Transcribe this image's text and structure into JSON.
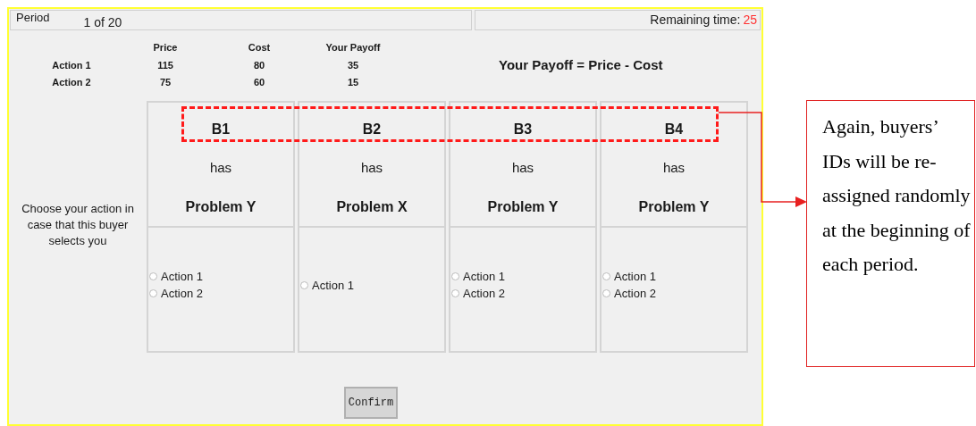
{
  "header": {
    "period_label": "Period",
    "period_value": "1 of 20",
    "remaining_label": "Remaining time:",
    "remaining_value": "25"
  },
  "payoff_table": {
    "columns": [
      "Price",
      "Cost",
      "Your Payoff"
    ],
    "rows": [
      {
        "label": "Action 1",
        "cells": [
          "115",
          "80",
          "35"
        ]
      },
      {
        "label": "Action 2",
        "cells": [
          "75",
          "60",
          "15"
        ]
      }
    ]
  },
  "formula": "Your Payoff = Price - Cost",
  "prompt": "Choose your action in case that this buyer selects you",
  "buyers": [
    {
      "id": "B1",
      "has": "has",
      "problem": "Problem Y",
      "options": [
        {
          "label": "Action 1",
          "selected": false
        },
        {
          "label": "Action 2",
          "selected": false
        }
      ]
    },
    {
      "id": "B2",
      "has": "has",
      "problem": "Problem X",
      "options": [
        {
          "label": "Action 1",
          "selected": false
        }
      ]
    },
    {
      "id": "B3",
      "has": "has",
      "problem": "Problem Y",
      "options": [
        {
          "label": "Action 1",
          "selected": false
        },
        {
          "label": "Action 2",
          "selected": false
        }
      ]
    },
    {
      "id": "B4",
      "has": "has",
      "problem": "Problem Y",
      "options": [
        {
          "label": "Action 1",
          "selected": false
        },
        {
          "label": "Action 2",
          "selected": false
        }
      ]
    }
  ],
  "confirm_button": "Confirm",
  "annotation": "Again, buyers’ IDs will be re-assigned randomly at the beginning of each period."
}
